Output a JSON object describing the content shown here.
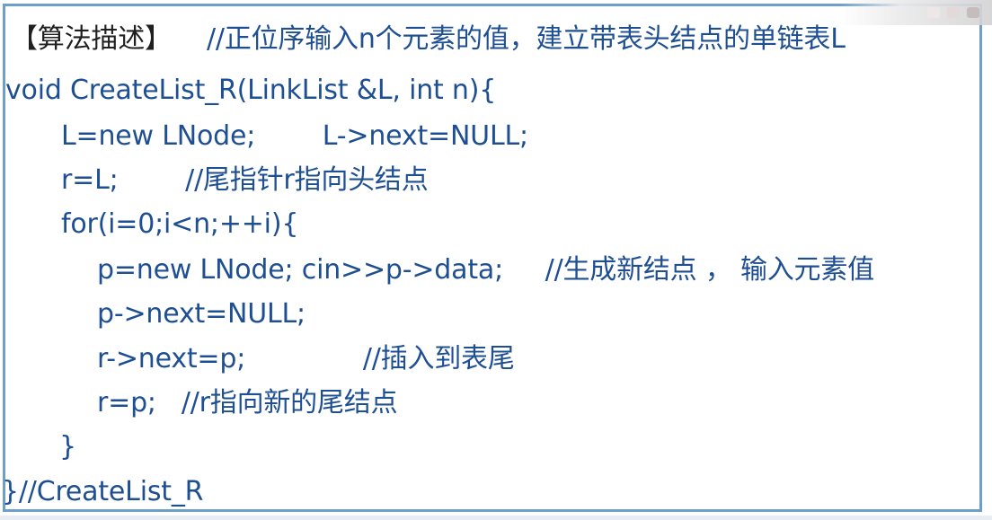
{
  "code": {
    "heading": "【算法描述】",
    "heading_comment": "//正位序输入n个元素的值，建立带表头结点的单链表L",
    "lines": [
      "void CreateList_R(LinkList &L, int n){",
      "L=new LNode;        L->next=NULL;",
      "r=L;        //尾指针r指向头结点",
      "for(i=0;i<n;++i){",
      "p=new LNode; cin>>p->data;     //生成新结点 ， 输入元素值",
      "p->next=NULL;",
      "r->next=p;              //插入到表尾",
      "r=p;   //r指向新的尾结点",
      "}",
      "}//CreateList_R"
    ]
  },
  "colors": {
    "text": "#1f4f93",
    "heading": "#1f1f1f",
    "border": "#6d9fc8"
  }
}
